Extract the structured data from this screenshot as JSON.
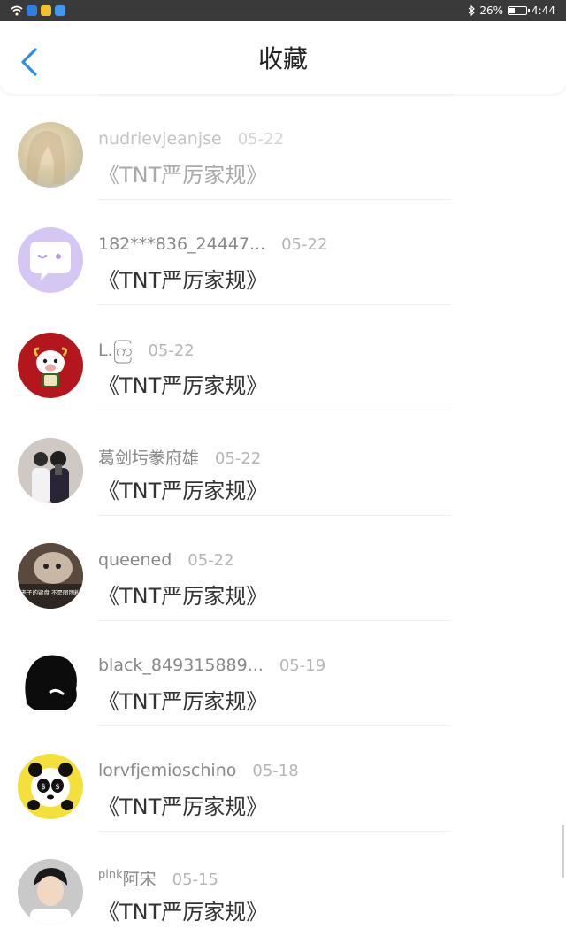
{
  "status": {
    "battery": "26%",
    "time": "4:44",
    "icons": [
      "wifi-icon",
      "app-notification-icon",
      "app-notification-icon",
      "cloud-icon",
      "bluetooth-icon",
      "battery-icon"
    ]
  },
  "header": {
    "title": "收藏",
    "back_icon": "chevron-left-icon",
    "accent": "#2a8ef0"
  },
  "items": [
    {
      "name": "nudrievjeanjse",
      "date": "05-22",
      "work": "《TNT严厉家规》",
      "faded": true
    },
    {
      "name": "182***836_24447...",
      "date": "05-22",
      "work": "《TNT严厉家规》"
    },
    {
      "name": "L.ကြ",
      "date": "05-22",
      "work": "《TNT严厉家规》"
    },
    {
      "name": "葛剑圬豢府雄",
      "date": "05-22",
      "work": "《TNT严厉家规》"
    },
    {
      "name": "queened",
      "date": "05-22",
      "work": "《TNT严厉家规》",
      "avatar_text": "老子的键盘 不是图团粉"
    },
    {
      "name": "black_849315889...",
      "date": "05-19",
      "work": "《TNT严厉家规》"
    },
    {
      "name": "lorvfjemioschino",
      "date": "05-18",
      "work": "《TNT严厉家规》"
    },
    {
      "name_prefix": "pink",
      "name": "阿宋",
      "date": "05-15",
      "work": "《TNT严厉家规》"
    }
  ]
}
